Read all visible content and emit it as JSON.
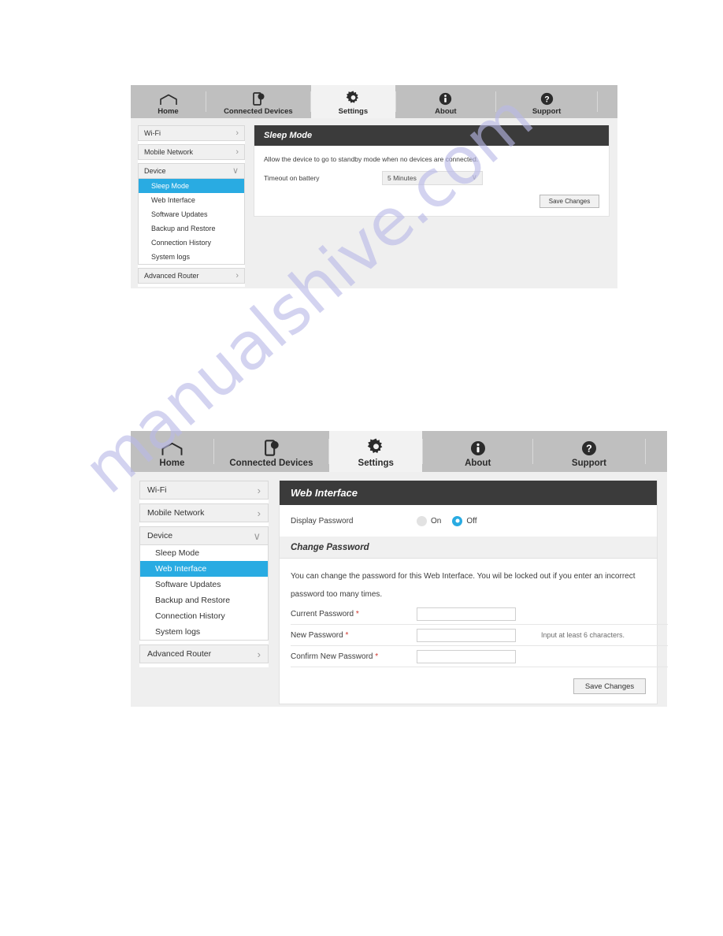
{
  "watermark": {
    "text": "manualshive.com"
  },
  "nav": {
    "tabs": [
      {
        "label": "Home",
        "icon": "home-icon",
        "active": false
      },
      {
        "label": "Connected Devices",
        "icon": "device-icon",
        "active": false
      },
      {
        "label": "Settings",
        "icon": "gear-icon",
        "active": true
      },
      {
        "label": "About",
        "icon": "info-circle-icon",
        "active": false
      },
      {
        "label": "Support",
        "icon": "question-circle-icon",
        "active": false
      }
    ]
  },
  "sidebar": {
    "groups": [
      {
        "label": "Wi-Fi",
        "chevron": "›"
      },
      {
        "label": "Mobile Network",
        "chevron": "›"
      },
      {
        "label": "Device",
        "chevron": "∨"
      }
    ],
    "advanced": {
      "label": "Advanced Router",
      "chevron": "›"
    },
    "device_items": [
      "Sleep Mode",
      "Web Interface",
      "Software Updates",
      "Backup and Restore",
      "Connection History",
      "System logs"
    ]
  },
  "colors": {
    "accent": "#29ABE2",
    "header_bar": "#3b3b3b",
    "nav_bg": "#bfbfbf",
    "panel_bg": "#efefef",
    "required": "#d0342c",
    "watermark": "#b9b9e8"
  },
  "panel1": {
    "active_sidebar_item": "Sleep Mode",
    "card_title": "Sleep Mode",
    "description": "Allow the device to go to standby mode when no devices are connected.",
    "timeout_label": "Timeout on battery",
    "timeout_value": "5 Minutes",
    "timeout_chevron": "∨",
    "save_label": "Save Changes"
  },
  "panel2": {
    "active_sidebar_item": "Web Interface",
    "card_title": "Web Interface",
    "display_password_label": "Display Password",
    "radio_on_label": "On",
    "radio_off_label": "Off",
    "radio_selected": "Off",
    "change_password_title": "Change Password",
    "description_line1": "You can change the password for this Web Interface. You wil be locked out if you enter an incorrect",
    "description_line2": "password too many times.",
    "fields": [
      {
        "label": "Current Password",
        "required": "*",
        "value": "",
        "hint": ""
      },
      {
        "label": "New Password",
        "required": "*",
        "value": "",
        "hint": "Input at least 6 characters."
      },
      {
        "label": "Confirm New Password",
        "required": "*",
        "value": "",
        "hint": ""
      }
    ],
    "save_label": "Save Changes"
  }
}
